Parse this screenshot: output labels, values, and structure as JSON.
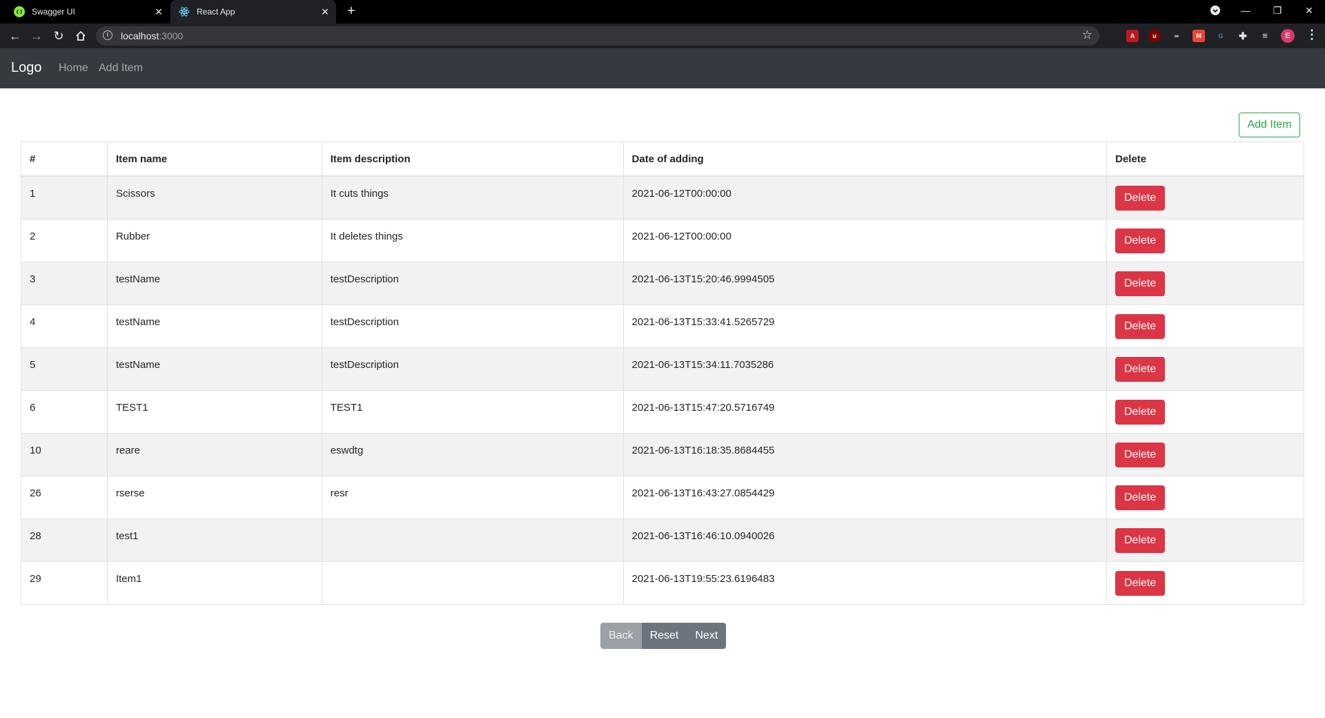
{
  "browser": {
    "tabs": [
      {
        "title": "Swagger UI",
        "icon": "swagger-icon",
        "active": false
      },
      {
        "title": "React App",
        "icon": "react-icon",
        "active": true
      }
    ],
    "address": {
      "host": "localhost",
      "port": ":3000"
    },
    "profile_initial": "E",
    "extensions": [
      "acrobat-icon",
      "ublock-icon",
      "glasses-icon",
      "gmail-icon",
      "translate-icon",
      "puzzle-icon",
      "reading-list-icon"
    ]
  },
  "navbar": {
    "brand": "Logo",
    "links": [
      "Home",
      "Add Item"
    ],
    "bg_color": "#343a40"
  },
  "main": {
    "add_button_label": "Add Item",
    "table": {
      "headers": [
        "#",
        "Item name",
        "Item description",
        "Date of adding",
        "Delete"
      ],
      "rows": [
        {
          "id": "1",
          "name": "Scissors",
          "description": "It cuts things",
          "date": "2021-06-12T00:00:00"
        },
        {
          "id": "2",
          "name": "Rubber",
          "description": "It deletes things",
          "date": "2021-06-12T00:00:00"
        },
        {
          "id": "3",
          "name": "testName",
          "description": "testDescription",
          "date": "2021-06-13T15:20:46.9994505"
        },
        {
          "id": "4",
          "name": "testName",
          "description": "testDescription",
          "date": "2021-06-13T15:33:41.5265729"
        },
        {
          "id": "5",
          "name": "testName",
          "description": "testDescription",
          "date": "2021-06-13T15:34:11.7035286"
        },
        {
          "id": "6",
          "name": "TEST1",
          "description": "TEST1",
          "date": "2021-06-13T15:47:20.5716749"
        },
        {
          "id": "10",
          "name": "reare",
          "description": "eswdtg",
          "date": "2021-06-13T16:18:35.8684455"
        },
        {
          "id": "26",
          "name": "rserse",
          "description": "resr",
          "date": "2021-06-13T16:43:27.0854429"
        },
        {
          "id": "28",
          "name": "test1",
          "description": "",
          "date": "2021-06-13T16:46:10.0940026"
        },
        {
          "id": "29",
          "name": "Item1",
          "description": "",
          "date": "2021-06-13T19:55:23.6196483"
        }
      ],
      "delete_label": "Delete"
    },
    "pagination": {
      "back": "Back",
      "reset": "Reset",
      "next": "Next"
    },
    "colors": {
      "delete": "#dc3545",
      "add": "#28a745",
      "pager": "#6c757d"
    }
  }
}
